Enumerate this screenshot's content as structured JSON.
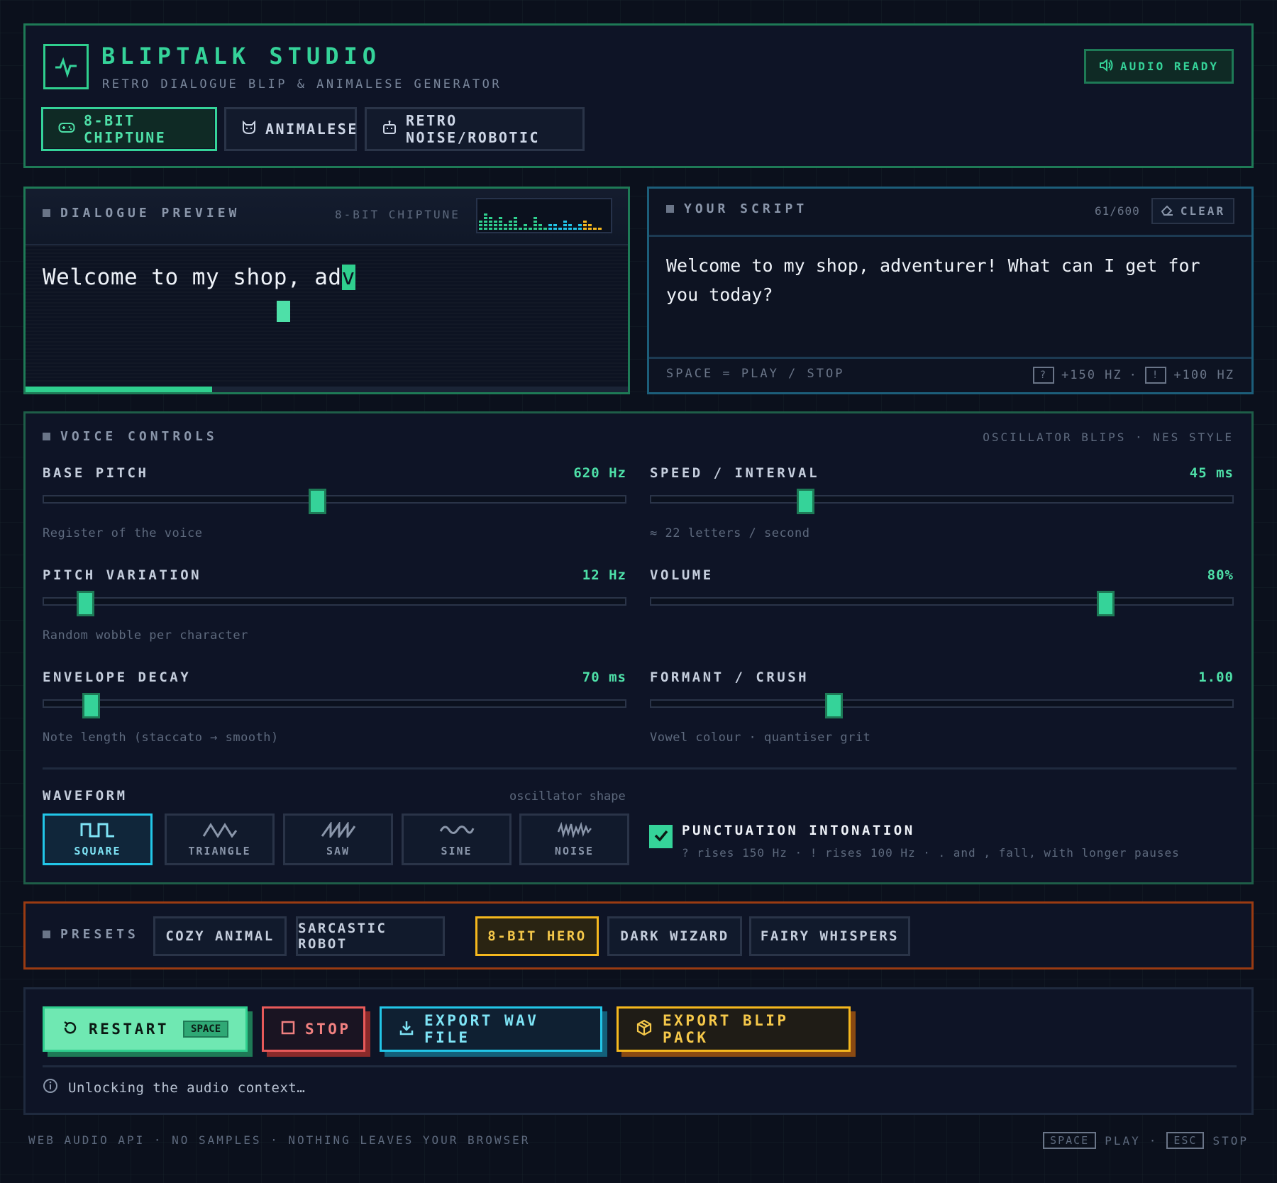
{
  "header": {
    "title": "BLIPTALK STUDIO",
    "subtitle": "RETRO DIALOGUE BLIP & ANIMALESE GENERATOR",
    "audio_status": "AUDIO READY",
    "modes": [
      {
        "label": "8-BIT CHIPTUNE",
        "icon": "gamepad-icon",
        "active": true
      },
      {
        "label": "ANIMALESE",
        "icon": "cat-icon",
        "active": false
      },
      {
        "label": "RETRO NOISE/ROBOTIC",
        "icon": "robot-icon",
        "active": false
      }
    ]
  },
  "preview": {
    "title": "DIALOGUE PREVIEW",
    "mode": "8-BIT CHIPTUNE",
    "text": "Welcome to my shop, ad",
    "current_char": "v",
    "progress": 0.31
  },
  "script": {
    "title": "YOUR SCRIPT",
    "count": "61/600",
    "clear_label": "CLEAR",
    "text": "Welcome to my shop, adventurer! What can I get for you today?",
    "hint": "SPACE = PLAY / STOP",
    "question_key": "?",
    "question_hz": "+150 HZ",
    "sep": "·",
    "exclaim_key": "!",
    "exclaim_hz": "+100 HZ"
  },
  "voice": {
    "title": "VOICE CONTROLS",
    "meta": "OSCILLATOR BLIPS · NES STYLE",
    "controls": [
      {
        "label": "BASE PITCH",
        "value": "620 Hz",
        "desc": "Register of the voice",
        "level": 0.47
      },
      {
        "label": "SPEED / INTERVAL",
        "value": "45 ms",
        "desc": "≈ 22 letters / second",
        "level": 0.26
      },
      {
        "label": "PITCH VARIATION",
        "value": "12 Hz",
        "desc": "Random wobble per character",
        "level": 0.06
      },
      {
        "label": "VOLUME",
        "value": "80%",
        "desc": "",
        "level": 0.79
      },
      {
        "label": "ENVELOPE DECAY",
        "value": "70 ms",
        "desc": "Note length (staccato → smooth)",
        "level": 0.07
      },
      {
        "label": "FORMANT / CRUSH",
        "value": "1.00",
        "desc": "Vowel colour · quantiser grit",
        "level": 0.31
      }
    ],
    "waveform_label": "WAVEFORM",
    "waveform_hint": "oscillator shape",
    "waveforms": [
      {
        "label": "SQUARE",
        "icon": "square-wave-icon",
        "active": true
      },
      {
        "label": "TRIANGLE",
        "icon": "triangle-wave-icon",
        "active": false
      },
      {
        "label": "SAW",
        "icon": "saw-wave-icon",
        "active": false
      },
      {
        "label": "SINE",
        "icon": "sine-wave-icon",
        "active": false
      },
      {
        "label": "NOISE",
        "icon": "noise-wave-icon",
        "active": false
      }
    ],
    "punctuation_title": "PUNCTUATION INTONATION",
    "punctuation_desc": "? rises 150 Hz · ! rises 100 Hz · . and , fall, with longer pauses",
    "punctuation_checked": true
  },
  "presets": {
    "title": "PRESETS",
    "items": [
      {
        "label": "COZY ANIMAL",
        "active": false
      },
      {
        "label": "SARCASTIC ROBOT",
        "active": false
      },
      {
        "label": "8-BIT HERO",
        "active": true
      },
      {
        "label": "DARK WIZARD",
        "active": false
      },
      {
        "label": "FAIRY WHISPERS",
        "active": false
      }
    ]
  },
  "actions": {
    "restart": "RESTART",
    "restart_key": "SPACE",
    "stop": "STOP",
    "export_wav": "EXPORT WAV FILE",
    "export_blip": "EXPORT BLIP PACK",
    "status": "Unlocking the audio context…"
  },
  "footer": {
    "left": "WEB AUDIO API · NO SAMPLES · NOTHING LEAVES YOUR BROWSER",
    "space_key": "SPACE",
    "play": "PLAY",
    "sep": "·",
    "esc_key": "ESC",
    "stop": "STOP"
  },
  "colors": {
    "accent": "#35d399",
    "background": "#0b101c",
    "panel": "#0e1426",
    "cyan": "#22c6e8",
    "amber": "#f5b81e",
    "red": "#e85a5a"
  }
}
